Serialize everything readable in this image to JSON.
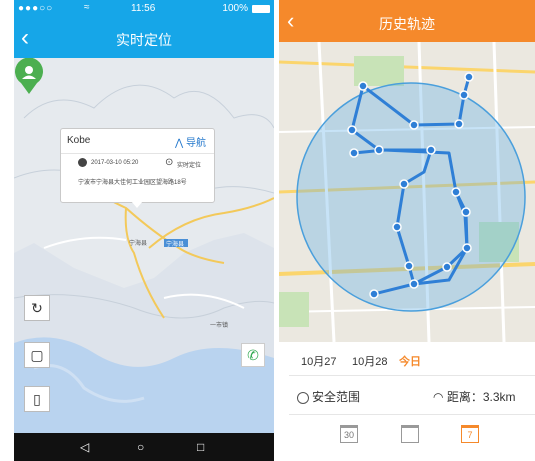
{
  "left": {
    "status": {
      "signal": "●●●○○",
      "wifi": "≈",
      "time": "11:56",
      "battery": "100%"
    },
    "title": "实时定位",
    "back_icon": "‹",
    "popup": {
      "name": "Kobe",
      "nav_label": "导航",
      "timestamp": "2017-03-10 05:20",
      "locate_label": "实时定位",
      "address": "宁波市宁海县大佳何工业园区望海路18号"
    },
    "map_labels": [
      "宁海县",
      "宁海县",
      "一市镇"
    ],
    "nav": {
      "back": "◁",
      "home": "○",
      "recent": "□"
    },
    "colors": {
      "header": "#16a6e8",
      "pin": "#4caf50"
    }
  },
  "right": {
    "title": "历史轨迹",
    "back_icon": "‹",
    "dates": [
      "10月27",
      "10月28",
      "今日"
    ],
    "safe_label": "安全范围",
    "distance_label": "距离：3.3km",
    "calendar_icons": [
      "30",
      "",
      "7"
    ],
    "colors": {
      "header": "#f5892b",
      "track": "#2f7fd6",
      "range": "#5fb0e8",
      "today": "#f5892b"
    }
  }
}
